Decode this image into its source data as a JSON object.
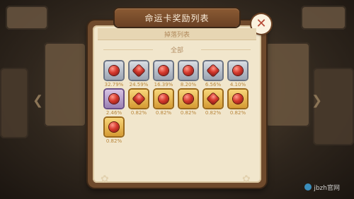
{
  "window": {
    "title": "命运卡奖励列表",
    "subheader": "掉落列表",
    "category_label": "全部"
  },
  "close_icon": "close-icon",
  "items": [
    {
      "percent": "32.79%",
      "frame": "silver",
      "icon": "red-gem-icon"
    },
    {
      "percent": "24.59%",
      "frame": "silver",
      "icon": "red-gem-icon"
    },
    {
      "percent": "16.39%",
      "frame": "silver",
      "icon": "red-gem-icon"
    },
    {
      "percent": "8.20%",
      "frame": "silver",
      "icon": "red-gem-icon"
    },
    {
      "percent": "6.56%",
      "frame": "silver",
      "icon": "red-gem-icon"
    },
    {
      "percent": "4.10%",
      "frame": "silver",
      "icon": "red-gem-icon"
    },
    {
      "percent": "2.46%",
      "frame": "purple",
      "icon": "red-gem-icon"
    },
    {
      "percent": "0.82%",
      "frame": "gold",
      "icon": "red-gem-icon"
    },
    {
      "percent": "0.82%",
      "frame": "gold",
      "icon": "red-gem-icon"
    },
    {
      "percent": "0.82%",
      "frame": "gold",
      "icon": "red-gem-icon"
    },
    {
      "percent": "0.82%",
      "frame": "gold",
      "icon": "red-gem-icon"
    },
    {
      "percent": "0.82%",
      "frame": "gold",
      "icon": "red-gem-icon"
    },
    {
      "percent": "0.82%",
      "frame": "gold",
      "icon": "red-gem-icon"
    }
  ],
  "watermark": "jbzh官网",
  "colors": {
    "panel_bg": "#f1e6cc",
    "frame_border": "#6f4a2c",
    "percent_text": "#b8863b"
  }
}
